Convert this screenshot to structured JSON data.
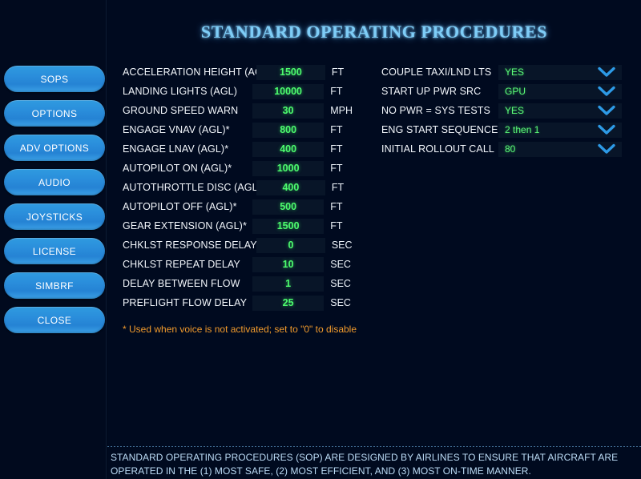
{
  "header": {
    "title": "STANDARD OPERATING PROCEDURES"
  },
  "colors": {
    "background": "#000a1e",
    "panel": "#081528",
    "title": "#7ecdf7",
    "value_green": "#4dfb6e",
    "button_blue": "#2a8ddb",
    "footnote_orange": "#f09a2c",
    "status_text": "#bcdcf6",
    "label_white": "#f2f6fb"
  },
  "sidebar": {
    "items": [
      {
        "label": "SOPS"
      },
      {
        "label": "OPTIONS"
      },
      {
        "label": "ADV OPTIONS"
      },
      {
        "label": "AUDIO"
      },
      {
        "label": "JOYSTICKS"
      },
      {
        "label": "LICENSE"
      },
      {
        "label": "SIMBRF"
      },
      {
        "label": "CLOSE"
      }
    ]
  },
  "numeric_settings": [
    {
      "label": "ACCELERATION HEIGHT (AGL)",
      "value": "1500",
      "unit": "FT"
    },
    {
      "label": "LANDING LIGHTS (AGL)",
      "value": "10000",
      "unit": "FT"
    },
    {
      "label": "GROUND SPEED WARN",
      "value": "30",
      "unit": "MPH"
    },
    {
      "label": "ENGAGE VNAV (AGL)*",
      "value": "800",
      "unit": "FT"
    },
    {
      "label": "ENGAGE LNAV (AGL)*",
      "value": "400",
      "unit": "FT"
    },
    {
      "label": "AUTOPILOT ON (AGL)*",
      "value": "1000",
      "unit": "FT"
    },
    {
      "label": "AUTOTHROTTLE DISC (AGL)*",
      "value": "400",
      "unit": "FT"
    },
    {
      "label": "AUTOPILOT OFF (AGL)*",
      "value": "500",
      "unit": "FT"
    },
    {
      "label": "GEAR EXTENSION (AGL)*",
      "value": "1500",
      "unit": "FT"
    },
    {
      "label": "CHKLST RESPONSE DELAY",
      "value": "0",
      "unit": "SEC"
    },
    {
      "label": "CHKLST REPEAT DELAY",
      "value": "10",
      "unit": "SEC"
    },
    {
      "label": "DELAY BETWEEN FLOW",
      "value": "1",
      "unit": "SEC"
    },
    {
      "label": "PREFLIGHT FLOW DELAY",
      "value": "25",
      "unit": "SEC"
    }
  ],
  "dropdown_settings": [
    {
      "label": "COUPLE TAXI/LND LTS",
      "value": "YES",
      "icon": "chevron-down-icon"
    },
    {
      "label": "START UP PWR SRC",
      "value": "GPU",
      "icon": "chevron-down-icon"
    },
    {
      "label": "NO PWR = SYS TESTS",
      "value": "YES",
      "icon": "chevron-down-icon"
    },
    {
      "label": "ENG START SEQUENCE",
      "value": "2 then 1",
      "icon": "chevron-down-icon"
    },
    {
      "label": "INITIAL ROLLOUT CALL",
      "value": "80",
      "icon": "chevron-down-icon"
    }
  ],
  "footnote": {
    "text": "* Used when voice is not activated; set to \"0\" to disable"
  },
  "status_bar": {
    "text": "STANDARD OPERATING PROCEDURES (SOP) ARE DESIGNED BY AIRLINES TO ENSURE THAT AIRCRAFT ARE OPERATED IN THE (1) MOST SAFE, (2) MOST EFFICIENT, AND (3) MOST ON-TIME MANNER."
  }
}
